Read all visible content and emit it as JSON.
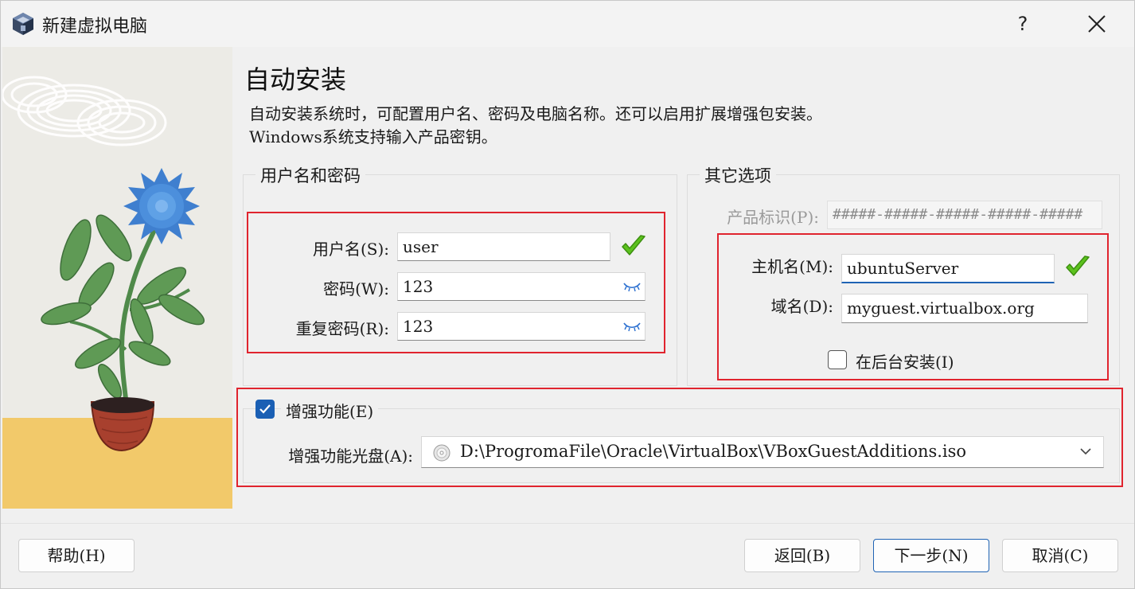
{
  "window": {
    "title": "新建虚拟电脑",
    "help_glyph": "?"
  },
  "page": {
    "heading": "自动安装",
    "description_line1": "自动安装系统时，可配置用户名、密码及电脑名称。还可以启用扩展增强包安装。",
    "description_line2": "Windows系统支持输入产品密钥。"
  },
  "user_group": {
    "title": "用户名和密码",
    "username_label": "用户名(S):",
    "username_value": "user",
    "password_label": "密码(W):",
    "password_value": "123",
    "repeat_label": "重复密码(R):",
    "repeat_value": "123"
  },
  "other_group": {
    "title": "其它选项",
    "product_key_label": "产品标识(P):",
    "product_key_value": "#####-#####-#####-#####-#####",
    "hostname_label": "主机名(M):",
    "hostname_value": "ubuntuServer",
    "domain_label": "域名(D):",
    "domain_value": "myguest.virtualbox.org",
    "background_label": "在后台安装(I)",
    "background_checked": false
  },
  "additions": {
    "checkbox_label": "增强功能(E)",
    "checked": true,
    "iso_label": "增强功能光盘(A):",
    "iso_value": "D:\\ProgromaFile\\Oracle\\VirtualBox\\VBoxGuestAdditions.iso"
  },
  "buttons": {
    "help": "帮助(H)",
    "back": "返回(B)",
    "next": "下一步(N)",
    "cancel": "取消(C)"
  },
  "colors": {
    "highlight_box": "#e0242e",
    "accent": "#1a5fb4",
    "valid_check": "#5cc21e"
  }
}
